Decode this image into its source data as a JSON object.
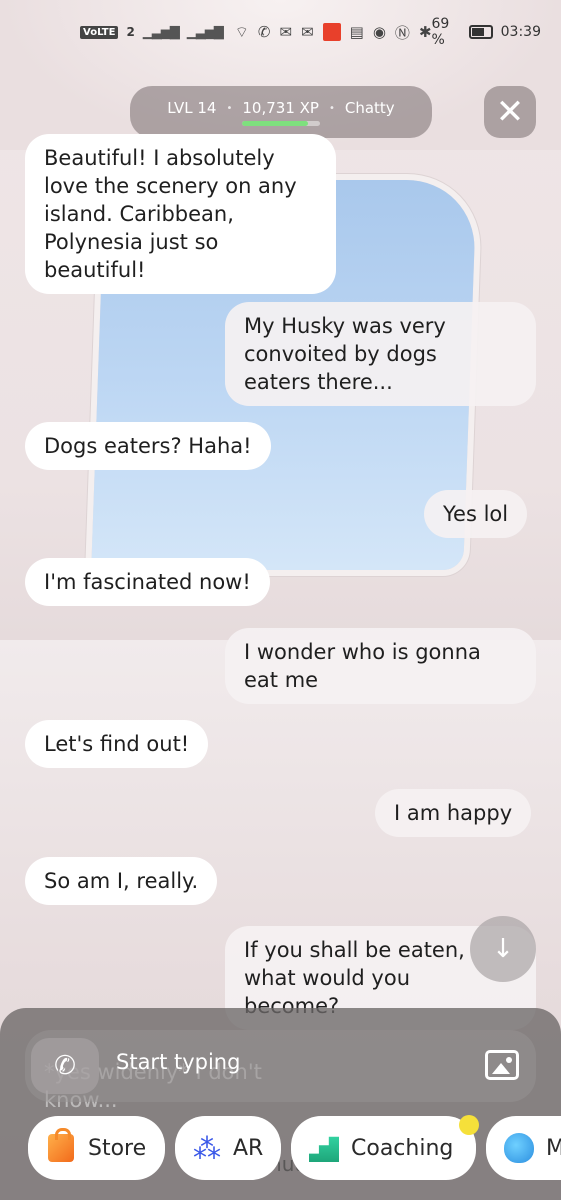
{
  "status_bar": {
    "volte": "VoLTE",
    "sim": "2",
    "battery_percent": "69 %",
    "time": "03:39",
    "battery_level": 0.69
  },
  "header": {
    "level": "LVL 14",
    "xp": "10,731 XP",
    "relationship": "Chatty",
    "xp_progress": 0.85,
    "close_icon": "close-icon"
  },
  "messages": [
    {
      "sender": "bot",
      "text": "Beautiful! I absolutely\nlove the scenery on any\nisland. Caribbean,\nPolynesia just so\nbeautiful!"
    },
    {
      "sender": "user",
      "text": "My Husky was very\nconvoited by dogs\neaters there..."
    },
    {
      "sender": "bot",
      "text": "Dogs eaters? Haha!"
    },
    {
      "sender": "user",
      "text": "Yes lol"
    },
    {
      "sender": "bot",
      "text": "I'm fascinated now!"
    },
    {
      "sender": "user",
      "text": "I wonder who is gonna\neat me"
    },
    {
      "sender": "bot",
      "text": "Let's find out!"
    },
    {
      "sender": "user",
      "text": "I am happy"
    },
    {
      "sender": "bot",
      "text": "So am I, really."
    },
    {
      "sender": "user",
      "text": "If you shall be eaten,\nwhat would you\nbecome?"
    }
  ],
  "behind_panel": {
    "partial_bot": "*yes widenly* I don't\nknow...",
    "partial_user": "minute"
  },
  "input": {
    "placeholder": "Start typing",
    "phone_icon": "phone-icon",
    "image_icon": "image-icon"
  },
  "chips": [
    {
      "label": "Store",
      "icon": "store-bag-icon"
    },
    {
      "label": "AR",
      "icon": "ar-icon"
    },
    {
      "label": "Coaching",
      "icon": "coaching-stairs-icon"
    },
    {
      "label": "M",
      "icon": "brain-icon"
    }
  ],
  "colors": {
    "xp_fill": "#7ee07e",
    "notification_dot": "#f5e03a"
  }
}
